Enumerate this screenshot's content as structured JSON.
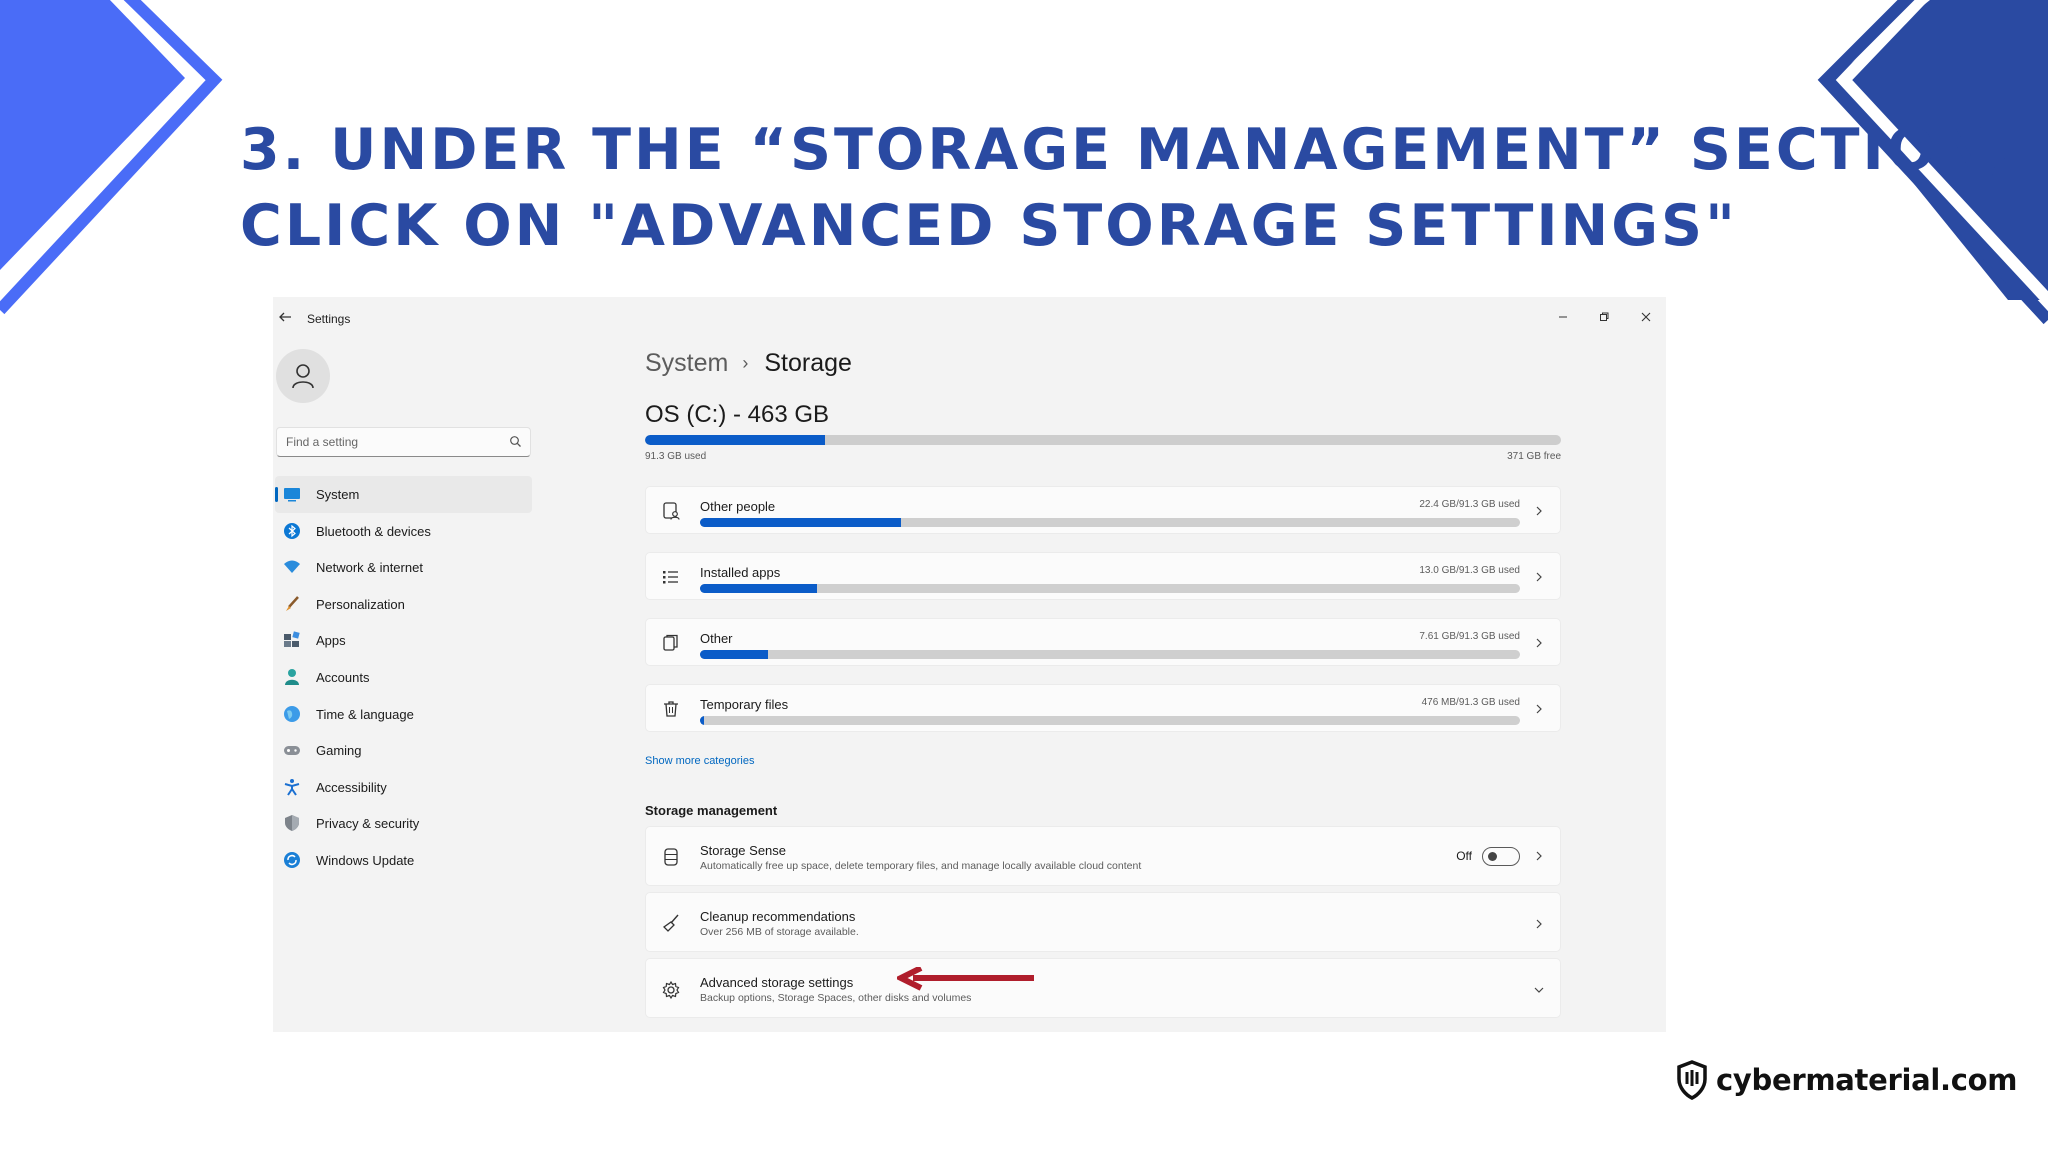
{
  "headline": {
    "line1": "3. Under the “Storage Management” section,",
    "line2": "click on \"Advanced Storage Settings\""
  },
  "brand": {
    "text": "cybermaterial.com"
  },
  "colors": {
    "accent_blue": "#2a4aa2",
    "deco_blue": "#4a6cf7",
    "deco_dark": "#2a4aa2",
    "arrow_red": "#b01e2c",
    "win_accent": "#0b5cc8"
  },
  "window": {
    "title": "Settings",
    "controls": {
      "minimize": "minimize-icon",
      "restore": "restore-icon",
      "close": "close-icon"
    }
  },
  "sidebar": {
    "search_placeholder": "Find a setting",
    "items": [
      {
        "label": "System",
        "icon": "system-icon",
        "active": true
      },
      {
        "label": "Bluetooth & devices",
        "icon": "bluetooth-icon"
      },
      {
        "label": "Network & internet",
        "icon": "wifi-icon"
      },
      {
        "label": "Personalization",
        "icon": "brush-icon"
      },
      {
        "label": "Apps",
        "icon": "apps-icon"
      },
      {
        "label": "Accounts",
        "icon": "accounts-icon"
      },
      {
        "label": "Time & language",
        "icon": "globe-icon"
      },
      {
        "label": "Gaming",
        "icon": "gamepad-icon"
      },
      {
        "label": "Accessibility",
        "icon": "accessibility-icon"
      },
      {
        "label": "Privacy & security",
        "icon": "shield-icon"
      },
      {
        "label": "Windows Update",
        "icon": "update-icon"
      }
    ]
  },
  "main": {
    "breadcrumb": {
      "parent": "System",
      "separator": "›",
      "current": "Storage"
    },
    "drive": {
      "label": "OS (C:) - 463 GB",
      "used": "91.3 GB used",
      "free": "371 GB free",
      "used_fraction": 0.197
    },
    "categories": [
      {
        "label": "Other people",
        "usage": "22.4 GB/91.3 GB used",
        "fraction": 0.245,
        "icon": "other-people-icon"
      },
      {
        "label": "Installed apps",
        "usage": "13.0 GB/91.3 GB used",
        "fraction": 0.143,
        "icon": "installed-apps-icon"
      },
      {
        "label": "Other",
        "usage": "7.61 GB/91.3 GB used",
        "fraction": 0.083,
        "icon": "other-icon"
      },
      {
        "label": "Temporary files",
        "usage": "476 MB/91.3 GB used",
        "fraction": 0.005,
        "icon": "trash-icon"
      }
    ],
    "show_more": "Show more categories",
    "storage_management": {
      "heading": "Storage management",
      "storage_sense": {
        "title": "Storage Sense",
        "desc": "Automatically free up space, delete temporary files, and manage locally available cloud content",
        "toggle_label": "Off"
      },
      "cleanup": {
        "title": "Cleanup recommendations",
        "desc": "Over 256 MB of storage available."
      },
      "advanced": {
        "title": "Advanced storage settings",
        "desc": "Backup options, Storage Spaces, other disks and volumes"
      }
    }
  }
}
